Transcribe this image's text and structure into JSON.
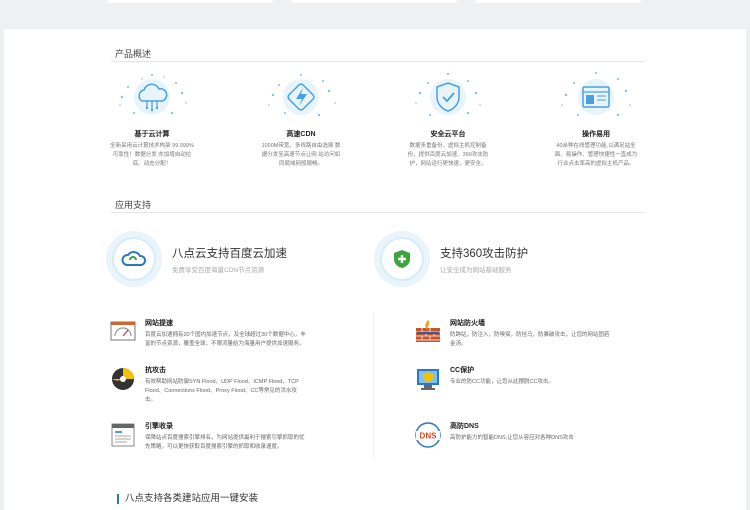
{
  "overview": {
    "title": "产品概述",
    "features": [
      {
        "icon": "cloud-computing-icon",
        "title": "基于云计算",
        "desc": [
          "全新采用云计算技术构架 99.999%",
          "可靠性！数据分发 亦加增自动拉",
          "底、动态分配！"
        ]
      },
      {
        "icon": "fast-cdn-icon",
        "title": "高速CDN",
        "desc": [
          "1000M带宽，多线路自由选择 数",
          "据分发至高速节点让网 站访问如",
          "同局域网般顺畅。"
        ]
      },
      {
        "icon": "shield-check-icon",
        "title": "安全云平台",
        "desc": [
          "数据多重备份，虚拟主机控制备",
          "份，提供百度云加速、360攻击防",
          "护，网站运行更快速，更安全。"
        ]
      },
      {
        "icon": "easy-operation-icon",
        "title": "操作易用",
        "desc": [
          "40余种在线管理功能,以满足站全",
          "面、易操作、管理快捷性一直成为",
          "行业点击率高的虚拟主机产品。"
        ]
      }
    ]
  },
  "support": {
    "title": "应用支持",
    "cards": [
      {
        "icon": "baidu-cloud-icon",
        "title": "八点云支持百度云加速",
        "sub": "免费享受百度海量CDN节点资源"
      },
      {
        "icon": "360-shield-icon",
        "title": "支持360攻击防护",
        "sub": "让安全成为网站基础服务"
      }
    ],
    "items": [
      {
        "icon": "website-speed-icon",
        "title": "网站提速",
        "desc": [
          "百度云加速拥有20个国内加速节点，及全球超过30个数据中心，丰",
          "富的节点资源，覆盖全球，不限流量给为海量用户提供加速服务。"
        ]
      },
      {
        "icon": "firewall-icon",
        "title": "网站防火墙",
        "desc": [
          "防跨站，防注入，防嗅探，防挂马，防暴破攻击，让您的网站固若",
          "金汤。"
        ]
      },
      {
        "icon": "anti-attack-icon",
        "title": "抗攻击",
        "desc": [
          "有效帮助网站防御SYN Flood、UDP Flood、ICMP Flood、TCP",
          "Flood、Connections Flood、Proxy Flood、CC等常见的洪水攻",
          "击。"
        ]
      },
      {
        "icon": "cc-protect-icon",
        "title": "CC保护",
        "desc": [
          "专业的防CC功能，让您从此摆脱CC攻击。"
        ]
      },
      {
        "icon": "search-engine-icon",
        "title": "引擎收录",
        "desc": [
          "保障站点百度搜索引擎排名，为网站提供最利于搜索引擎抓取的优",
          "先策略，可以更快获取百度搜索引擎的抓取和收录速度。"
        ]
      },
      {
        "icon": "dns-icon",
        "title": "高防DNS",
        "desc": [
          "高防护能力的智能DNS,让您从容应对各种DNS攻击"
        ]
      }
    ]
  },
  "footer": {
    "title": "八点支持各类建站应用一键安装"
  },
  "colors": {
    "accent": "#2a78c5",
    "icon_blue": "#4a9fe0",
    "green": "#3aa53a"
  }
}
